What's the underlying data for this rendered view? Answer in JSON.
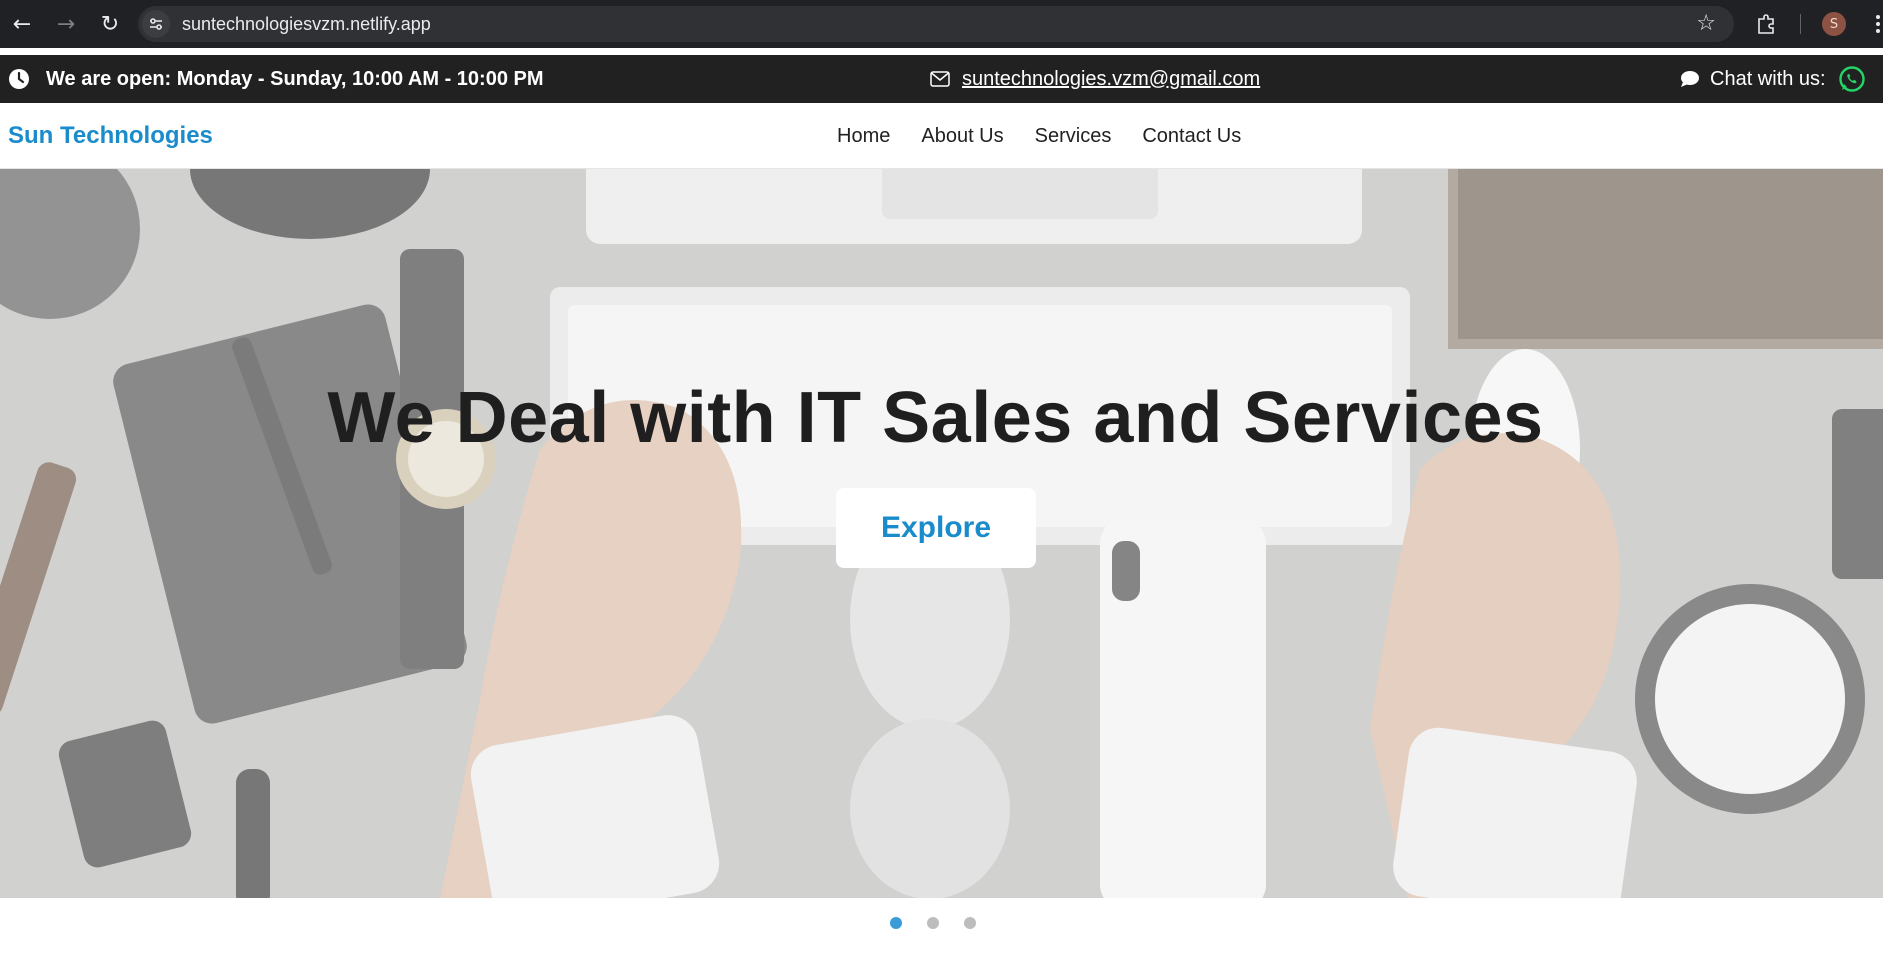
{
  "browser": {
    "url": "suntechnologiesvzm.netlify.app",
    "profile_initial": "S"
  },
  "infobar": {
    "hours": "We are open: Monday - Sunday, 10:00 AM - 10:00 PM",
    "email": "suntechnologies.vzm@gmail.com",
    "chat_label": "Chat with us:"
  },
  "navbar": {
    "brand": "Sun Technologies",
    "items": [
      {
        "label": "Home"
      },
      {
        "label": "About Us"
      },
      {
        "label": "Services"
      },
      {
        "label": "Contact Us"
      }
    ]
  },
  "hero": {
    "title": "We Deal with IT Sales and Services",
    "button_label": "Explore"
  },
  "carousel": {
    "slide_count": 3,
    "active_index": 0
  },
  "colors": {
    "brand_blue": "#1a8ccc",
    "infobar_bg": "#212121",
    "active_dot": "#3a9bd6",
    "whatsapp_green": "#25d366"
  },
  "icons": [
    "back-arrow-icon",
    "forward-arrow-icon",
    "reload-icon",
    "site-settings-icon",
    "bookmark-star-icon",
    "extensions-icon",
    "clock-icon",
    "envelope-icon",
    "chat-bubble-icon",
    "whatsapp-icon"
  ]
}
